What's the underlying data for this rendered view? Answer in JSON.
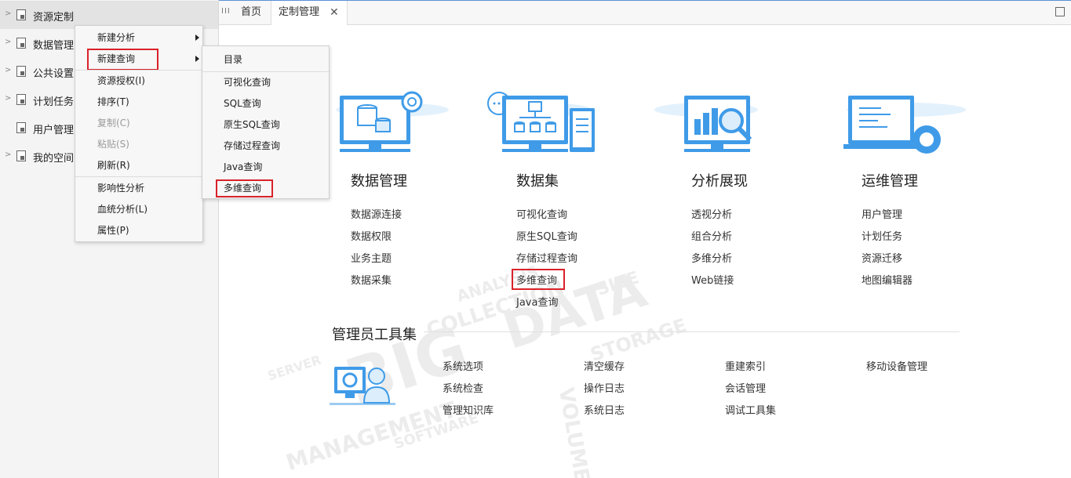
{
  "sidebar": {
    "items": [
      {
        "label": "资源定制"
      },
      {
        "label": "数据管理"
      },
      {
        "label": "公共设置"
      },
      {
        "label": "计划任务"
      },
      {
        "label": "用户管理"
      },
      {
        "label": "我的空间"
      }
    ]
  },
  "tabs": {
    "grip": "III",
    "items": [
      {
        "label": "首页"
      },
      {
        "label": "定制管理"
      }
    ],
    "close": "✕"
  },
  "context_menu": {
    "items": [
      {
        "label": "新建分析",
        "submenu": true,
        "enabled": true
      },
      {
        "label": "新建查询",
        "submenu": true,
        "enabled": true,
        "highlighted": true
      },
      {
        "label": "资源授权(I)",
        "enabled": true
      },
      {
        "label": "排序(T)",
        "enabled": true
      },
      {
        "label": "复制(C)",
        "enabled": false
      },
      {
        "label": "粘贴(S)",
        "enabled": false
      },
      {
        "label": "刷新(R)",
        "enabled": true
      },
      {
        "label": "影响性分析",
        "enabled": true
      },
      {
        "label": "血统分析(L)",
        "enabled": true
      },
      {
        "label": "属性(P)",
        "enabled": true
      }
    ]
  },
  "submenu": {
    "items": [
      {
        "label": "目录"
      },
      {
        "label": "可视化查询"
      },
      {
        "label": "SQL查询"
      },
      {
        "label": "原生SQL查询"
      },
      {
        "label": "存储过程查询"
      },
      {
        "label": "Java查询"
      },
      {
        "label": "多维查询",
        "highlighted": true
      }
    ]
  },
  "columns": [
    {
      "title": "数据管理",
      "links": [
        "数据源连接",
        "数据权限",
        "业务主题",
        "数据采集"
      ]
    },
    {
      "title": "数据集",
      "links": [
        "可视化查询",
        "原生SQL查询",
        "存储过程查询",
        "多维查询",
        "Java查询"
      ]
    },
    {
      "title": "分析展现",
      "links": [
        "透视分析",
        "组合分析",
        "多维分析",
        "Web链接"
      ]
    },
    {
      "title": "运维管理",
      "links": [
        "用户管理",
        "计划任务",
        "资源迁移",
        "地图编辑器"
      ]
    }
  ],
  "admin": {
    "title": "管理员工具集",
    "links": [
      [
        "系统选项",
        "系统检查",
        "管理知识库"
      ],
      [
        "清空缓存",
        "操作日志",
        "系统日志"
      ],
      [
        "重建索引",
        "会话管理",
        "调试工具集"
      ],
      [
        "移动设备管理"
      ]
    ]
  },
  "background_words": [
    "BIG",
    "DATA",
    "COLLECTION",
    "ANALYSIS",
    "STORAGE",
    "MANAGEMENT",
    "SOFTWARE",
    "VOLUME",
    "SIZE",
    "SERVER"
  ],
  "colors": {
    "accent": "#2a8ee0",
    "highlight_box": "#d9222a",
    "illustration_blue": "#3f9be8",
    "illustration_light": "#dceefb"
  }
}
